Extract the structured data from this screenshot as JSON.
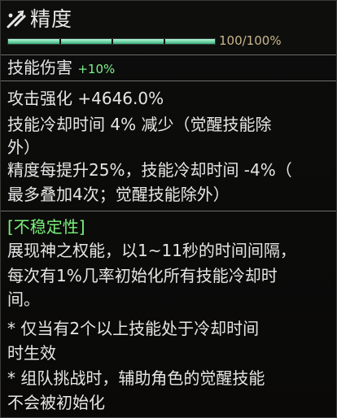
{
  "header": {
    "title": "精度",
    "progress": 1.0,
    "progress_label": "100/100%"
  },
  "skill_damage": {
    "label": "技能伤害",
    "value": "+10%"
  },
  "stats": {
    "attack_boost": "攻击强化 +4646.0%",
    "cooldown_line1": "技能冷却时间 4% 减少（觉醒技能除",
    "cooldown_line2": "外）",
    "precision_line1": "精度每提升25%，技能冷却时间 -4%（",
    "precision_line2": "最多叠加4次；觉醒技能除外）"
  },
  "instability": {
    "tag": "[不稳定性]",
    "desc_line1": "展现神之权能，以1~11秒的时间间隔，",
    "desc_line2": "每次有1%几率初始化所有技能冷却时",
    "desc_line3": "间。",
    "note1_line1": " * 仅当有2个以上技能处于冷却时间",
    "note1_line2": "时生效",
    "note2_line1": " * 组队挑战时，辅助角色的觉醒技能",
    "note2_line2": "不会被初始化"
  },
  "colors": {
    "accent_green": "#7af07a",
    "bar_fill": "#6fd6a6",
    "progress_text": "#c9b68a",
    "text": "#e6e6e6"
  },
  "icons": {
    "title": "precision-crosshair-icon"
  }
}
